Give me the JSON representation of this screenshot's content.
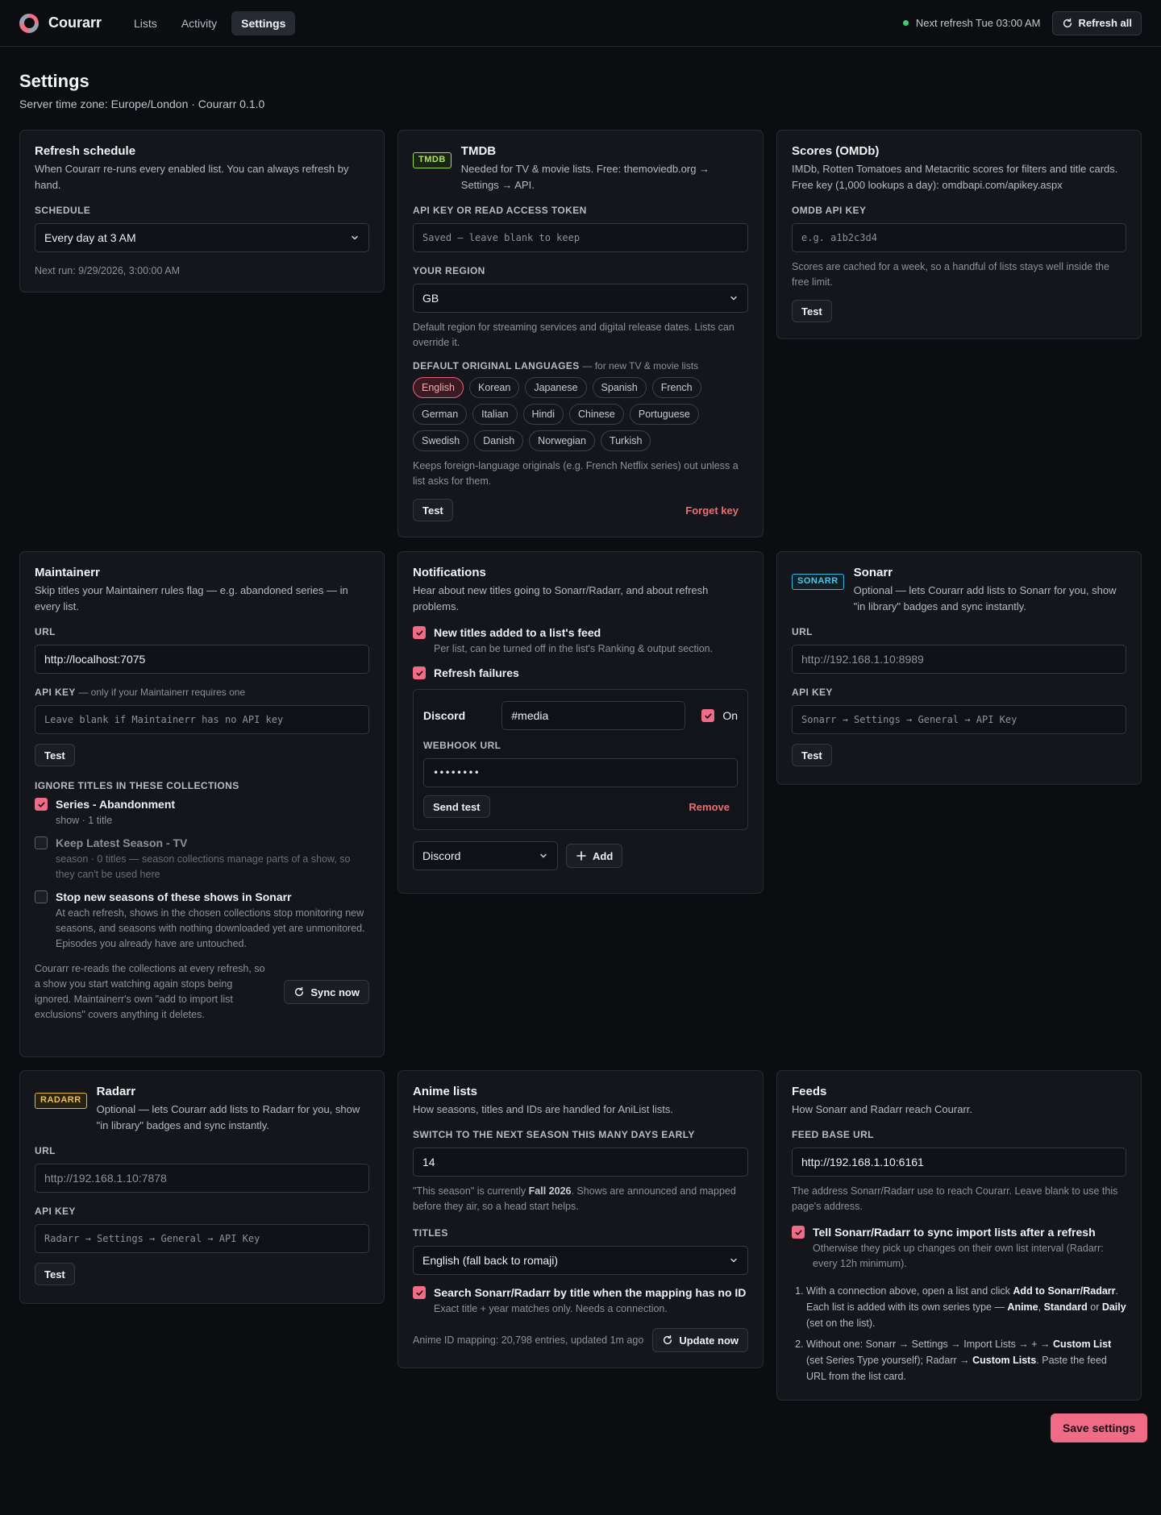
{
  "app": {
    "name": "Courarr"
  },
  "nav": {
    "tabs": [
      {
        "label": "Lists"
      },
      {
        "label": "Activity"
      },
      {
        "label": "Settings"
      }
    ]
  },
  "topbar": {
    "next_refresh": "Next refresh Tue 03:00 AM",
    "refresh_all_label": "Refresh all"
  },
  "page": {
    "title": "Settings",
    "subtitle": "Server time zone: Europe/London · Courarr 0.1.0"
  },
  "refresh": {
    "title": "Refresh schedule",
    "desc": "When Courarr re-runs every enabled list. You can always refresh by hand.",
    "schedule_label": "SCHEDULE",
    "schedule_value": "Every day at 3 AM",
    "next_run": "Next run: 9/29/2026, 3:00:00 AM"
  },
  "tmdb": {
    "badge": "TMDB",
    "title": "TMDB",
    "desc": "Needed for TV & movie lists. Free: themoviedb.org → Settings → API.",
    "key_label": "API KEY OR READ ACCESS TOKEN",
    "key_placeholder": "Saved — leave blank to keep",
    "region_label": "YOUR REGION",
    "region_value": "GB",
    "region_hint": "Default region for streaming services and digital release dates. Lists can override it.",
    "lang_label": "DEFAULT ORIGINAL LANGUAGES",
    "lang_note": "— for new TV & movie lists",
    "languages": [
      "English",
      "Korean",
      "Japanese",
      "Spanish",
      "French",
      "German",
      "Italian",
      "Hindi",
      "Chinese",
      "Portuguese",
      "Swedish",
      "Danish",
      "Norwegian",
      "Turkish"
    ],
    "selected_language": "English",
    "lang_hint": "Keeps foreign-language originals (e.g. French Netflix series) out unless a list asks for them.",
    "test_label": "Test",
    "forget_label": "Forget key"
  },
  "omdb": {
    "title": "Scores (OMDb)",
    "desc": "IMDb, Rotten Tomatoes and Metacritic scores for filters and title cards. Free key (1,000 lookups a day): omdbapi.com/apikey.aspx",
    "key_label": "OMDB API KEY",
    "key_placeholder": "e.g. a1b2c3d4",
    "hint": "Scores are cached for a week, so a handful of lists stays well inside the free limit.",
    "test_label": "Test"
  },
  "maintainerr": {
    "title": "Maintainerr",
    "desc": "Skip titles your Maintainerr rules flag — e.g. abandoned series — in every list.",
    "url_label": "URL",
    "url_value": "http://localhost:7075",
    "key_label": "API KEY",
    "key_note": "— only if your Maintainerr requires one",
    "key_placeholder": "Leave blank if Maintainerr has no API key",
    "test_label": "Test",
    "collections_label": "IGNORE TITLES IN THESE COLLECTIONS",
    "collections": [
      {
        "name": "Series - Abandonment",
        "sub": "show · 1 title",
        "checked": true
      },
      {
        "name": "Keep Latest Season - TV",
        "sub": "season · 0 titles — season collections manage parts of a show, so they can't be used here",
        "checked": false
      }
    ],
    "stop_label": "Stop new seasons of these shows in Sonarr",
    "stop_sub": "At each refresh, shows in the chosen collections stop monitoring new seasons, and seasons with nothing downloaded yet are unmonitored. Episodes you already have are untouched.",
    "footer": "Courarr re-reads the collections at every refresh, so a show you start watching again stops being ignored. Maintainerr's own \"add to import list exclusions\" covers anything it deletes.",
    "sync_label": "Sync now"
  },
  "notifications": {
    "title": "Notifications",
    "desc": "Hear about new titles going to Sonarr/Radarr, and about refresh problems.",
    "opt1_label": "New titles added to a list's feed",
    "opt1_sub": "Per list, can be turned off in the list's Ranking & output section.",
    "opt2_label": "Refresh failures",
    "channel": {
      "name": "Discord",
      "tag": "#media",
      "on_label": "On",
      "webhook_label": "WEBHOOK URL",
      "webhook_value": "••••••••",
      "send_test_label": "Send test",
      "remove_label": "Remove"
    },
    "add_type": "Discord",
    "add_label": "Add"
  },
  "sonarr": {
    "badge": "SONARR",
    "title": "Sonarr",
    "desc": "Optional — lets Courarr add lists to Sonarr for you, show \"in library\" badges and sync instantly.",
    "url_label": "URL",
    "url_placeholder": "http://192.168.1.10:8989",
    "key_label": "API KEY",
    "key_placeholder": "Sonarr → Settings → General → API Key",
    "test_label": "Test"
  },
  "radarr": {
    "badge": "RADARR",
    "title": "Radarr",
    "desc": "Optional — lets Courarr add lists to Radarr for you, show \"in library\" badges and sync instantly.",
    "url_label": "URL",
    "url_placeholder": "http://192.168.1.10:7878",
    "key_label": "API KEY",
    "key_placeholder": "Radarr → Settings → General → API Key",
    "test_label": "Test"
  },
  "anime": {
    "title": "Anime lists",
    "desc": "How seasons, titles and IDs are handled for AniList lists.",
    "days_label": "SWITCH TO THE NEXT SEASON THIS MANY DAYS EARLY",
    "days_value": "14",
    "hint_pre": "\"This season\" is currently ",
    "hint_season": "Fall 2026",
    "hint_post": ". Shows are announced and mapped before they air, so a head start helps.",
    "titles_label": "TITLES",
    "titles_value": "English (fall back to romaji)",
    "search_label": "Search Sonarr/Radarr by title when the mapping has no ID",
    "search_sub": "Exact title + year matches only. Needs a connection.",
    "mapping_status": "Anime ID mapping: 20,798 entries, updated 1m ago",
    "update_label": "Update now"
  },
  "feeds": {
    "title": "Feeds",
    "desc": "How Sonarr and Radarr reach Courarr.",
    "base_label": "FEED BASE URL",
    "base_value": "http://192.168.1.10:6161",
    "base_hint": "The address Sonarr/Radarr use to reach Courarr. Leave blank to use this page's address.",
    "sync_label": "Tell Sonarr/Radarr to sync import lists after a refresh",
    "sync_sub": "Otherwise they pick up changes on their own list interval (Radarr: every 12h minimum).",
    "step1": {
      "a": "With a connection above, open a list and click ",
      "b": "Add to Sonarr/Radarr",
      "c": ". Each list is added with its own series type — ",
      "d": "Anime",
      "e": ", ",
      "f": "Standard",
      "g": " or ",
      "h": "Daily",
      "i": " (set on the list)."
    },
    "step2": {
      "a": "Without one: Sonarr → Settings → Import Lists → + → ",
      "b": "Custom List",
      "c": " (set Series Type yourself); Radarr → ",
      "d": "Custom Lists",
      "e": ". Paste the feed URL from the list card."
    }
  },
  "save_label": "Save settings"
}
